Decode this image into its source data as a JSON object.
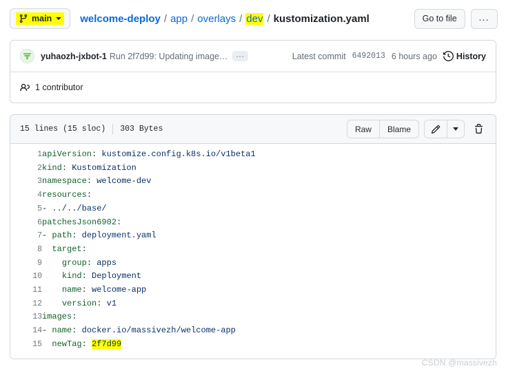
{
  "topbar": {
    "branch": {
      "name": "main",
      "icon": "git-branch-icon",
      "highlight_color": "#ffff00"
    },
    "breadcrumb": {
      "repo": "welcome-deploy",
      "segments": [
        "app",
        "overlays",
        "dev"
      ],
      "highlighted_segment": "dev",
      "separator": "/",
      "current_file": "kustomization.yaml"
    },
    "go_to_file_label": "Go to file",
    "more_options_label": "..."
  },
  "commit": {
    "author": "yuhaozh-jxbot-1",
    "message": "Run 2f7d99: Updating image…",
    "expand_label": "...",
    "latest_commit_label": "Latest commit",
    "sha": "6492013",
    "time": "6 hours ago",
    "history_label": "History",
    "history_icon": "clock-history-icon"
  },
  "contributors": {
    "icon": "people-icon",
    "text": "1 contributor"
  },
  "file": {
    "lines_label": "15 lines (15 sloc)",
    "size_label": "303 Bytes",
    "actions": {
      "raw": "Raw",
      "blame": "Blame",
      "edit_icon": "pencil-icon",
      "edit_dropdown_icon": "chevron-down-icon",
      "delete_icon": "trash-icon"
    },
    "code_lines": [
      {
        "n": "1",
        "parts": [
          {
            "t": "apiVersion",
            "c": "k"
          },
          {
            "t": ": ",
            "c": "p"
          },
          {
            "t": "kustomize.config.k8s.io/v1beta1",
            "c": "v"
          }
        ]
      },
      {
        "n": "2",
        "parts": [
          {
            "t": "kind",
            "c": "k"
          },
          {
            "t": ": ",
            "c": "p"
          },
          {
            "t": "Kustomization",
            "c": "v"
          }
        ]
      },
      {
        "n": "3",
        "parts": [
          {
            "t": "namespace",
            "c": "k"
          },
          {
            "t": ": ",
            "c": "p"
          },
          {
            "t": "welcome-dev",
            "c": "v"
          }
        ]
      },
      {
        "n": "4",
        "parts": [
          {
            "t": "resources",
            "c": "k"
          },
          {
            "t": ":",
            "c": "p"
          }
        ]
      },
      {
        "n": "5",
        "parts": [
          {
            "t": "- ",
            "c": "p"
          },
          {
            "t": "../../base/",
            "c": "v"
          }
        ]
      },
      {
        "n": "6",
        "parts": [
          {
            "t": "patchesJson6902",
            "c": "k"
          },
          {
            "t": ":",
            "c": "p"
          }
        ]
      },
      {
        "n": "7",
        "parts": [
          {
            "t": "- ",
            "c": "p"
          },
          {
            "t": "path",
            "c": "k"
          },
          {
            "t": ": ",
            "c": "p"
          },
          {
            "t": "deployment.yaml",
            "c": "v"
          }
        ]
      },
      {
        "n": "8",
        "parts": [
          {
            "t": "  ",
            "c": "p"
          },
          {
            "t": "target",
            "c": "k"
          },
          {
            "t": ":",
            "c": "p"
          }
        ]
      },
      {
        "n": "9",
        "parts": [
          {
            "t": "    ",
            "c": "p"
          },
          {
            "t": "group",
            "c": "k"
          },
          {
            "t": ": ",
            "c": "p"
          },
          {
            "t": "apps",
            "c": "v"
          }
        ]
      },
      {
        "n": "10",
        "parts": [
          {
            "t": "    ",
            "c": "p"
          },
          {
            "t": "kind",
            "c": "k"
          },
          {
            "t": ": ",
            "c": "p"
          },
          {
            "t": "Deployment",
            "c": "v"
          }
        ]
      },
      {
        "n": "11",
        "parts": [
          {
            "t": "    ",
            "c": "p"
          },
          {
            "t": "name",
            "c": "k"
          },
          {
            "t": ": ",
            "c": "p"
          },
          {
            "t": "welcome-app",
            "c": "v"
          }
        ]
      },
      {
        "n": "12",
        "parts": [
          {
            "t": "    ",
            "c": "p"
          },
          {
            "t": "version",
            "c": "k"
          },
          {
            "t": ": ",
            "c": "p"
          },
          {
            "t": "v1",
            "c": "v"
          }
        ]
      },
      {
        "n": "13",
        "parts": [
          {
            "t": "images",
            "c": "k"
          },
          {
            "t": ":",
            "c": "p"
          }
        ]
      },
      {
        "n": "14",
        "parts": [
          {
            "t": "- ",
            "c": "p"
          },
          {
            "t": "name",
            "c": "k"
          },
          {
            "t": ": ",
            "c": "p"
          },
          {
            "t": "docker.io/massivezh/welcome-app",
            "c": "v"
          }
        ]
      },
      {
        "n": "15",
        "parts": [
          {
            "t": "  ",
            "c": "p"
          },
          {
            "t": "newTag",
            "c": "k"
          },
          {
            "t": ": ",
            "c": "p"
          },
          {
            "t": "2f7d99",
            "c": "v",
            "hl": true
          }
        ]
      }
    ]
  },
  "watermark": "CSDN @massivezh"
}
